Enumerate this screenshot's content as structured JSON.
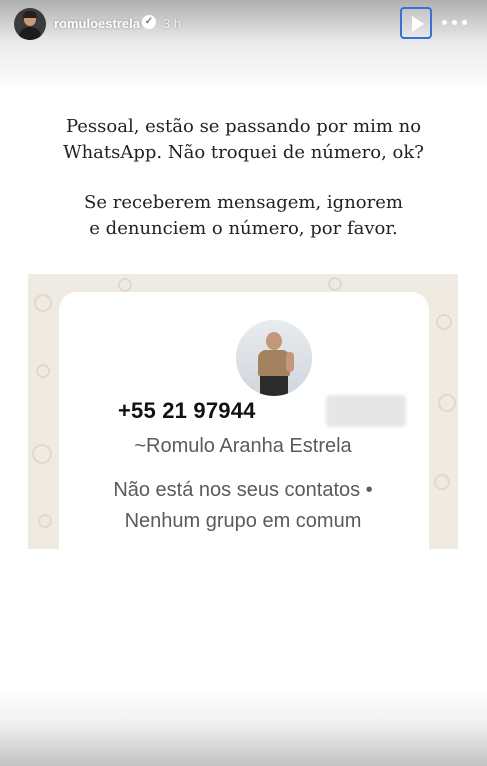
{
  "header": {
    "username": "romuloestrela",
    "verified_icon": "verified-check-icon",
    "verified_glyph": "✓",
    "time": "3 h",
    "play_icon": "play-icon",
    "more_icon": "more-options-icon"
  },
  "caption": {
    "line1": "Pessoal, estão se passando por mim no",
    "line2": "WhatsApp. Não troquei de número, ok?",
    "line3": "Se receberem mensagem, ignorem",
    "line4": "e denunciem o número, por favor."
  },
  "whatsapp_card": {
    "phone_number": "+55 21 97944",
    "contact_name": "~Romulo Aranha Estrela",
    "status_line1": "Não está nos seus contatos •",
    "status_line2": "Nenhum grupo em comum"
  },
  "colors": {
    "play_button_border": "#3b6fd6",
    "whatsapp_bg": "#efeae2"
  }
}
